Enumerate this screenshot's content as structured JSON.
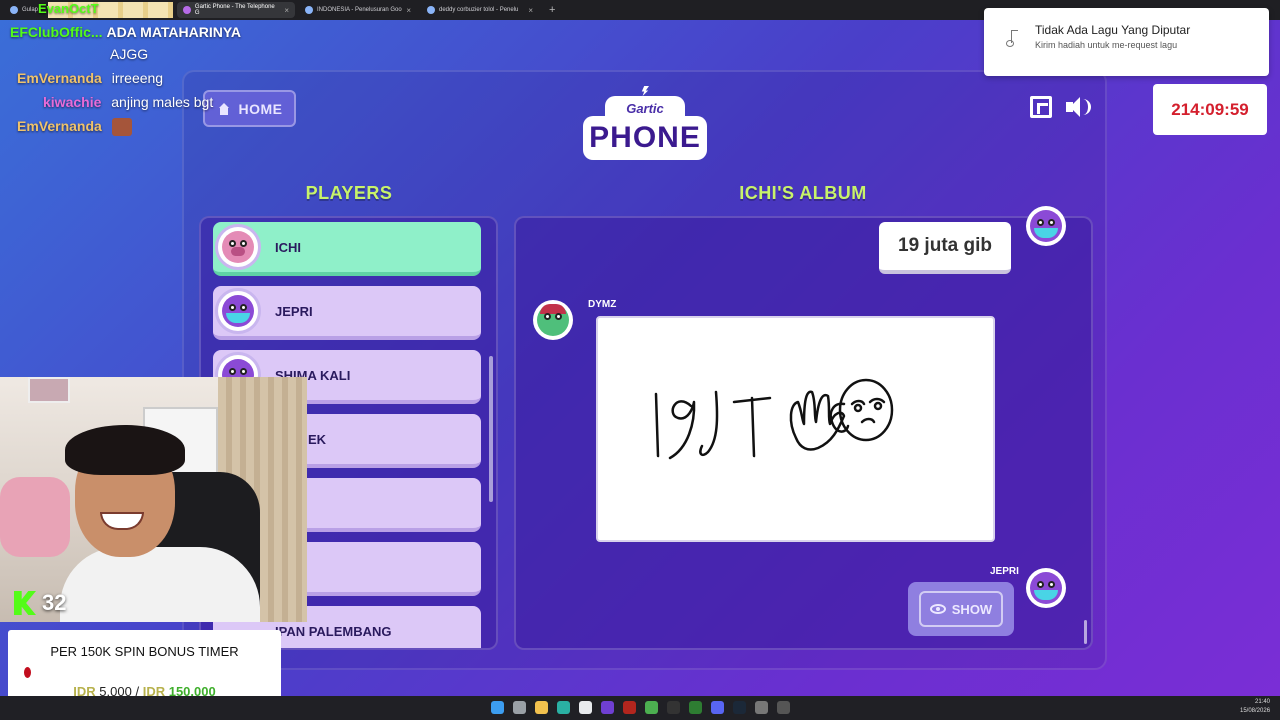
{
  "browser": {
    "tabs": [
      {
        "label": "Gulap"
      },
      {
        "label": "Gartic Phone - The Telephone G"
      },
      {
        "label": "INDONESIA - Penelusuran Goo"
      },
      {
        "label": "deddy corbuzier tolol - Penelu"
      }
    ],
    "new_tab": "+"
  },
  "chat": [
    {
      "user": "EvanOctT",
      "message": "",
      "color": "#53fc18"
    },
    {
      "user": "EFClubOffic...",
      "message": "ADA MATAHARINYA",
      "color": "#53fc18"
    },
    {
      "user": "",
      "message": "AJGG",
      "color": "#ffffff"
    },
    {
      "user": "EmVernanda",
      "message": "irreeeng",
      "color": "#f0c36a"
    },
    {
      "user": "kiwachie",
      "message": "anjing males bgt",
      "color": "#e86bd8"
    },
    {
      "user": "EmVernanda",
      "message": "",
      "color": "#f0c36a"
    }
  ],
  "game": {
    "home_label": "HOME",
    "logo_top": "Gartic",
    "logo_main": "PHONE",
    "players_title": "PLAYERS",
    "album_title": "ICHI'S ALBUM",
    "players": [
      {
        "name": "ICHI",
        "avatar": "pig",
        "active": true
      },
      {
        "name": "JEPRI",
        "avatar": "bird",
        "active": false
      },
      {
        "name": "SHIMA KALI",
        "avatar": "bird",
        "active": false
      },
      {
        "name": "EK",
        "avatar": "bird",
        "active": false
      },
      {
        "name": "",
        "avatar": "bird",
        "active": false
      },
      {
        "name": "",
        "avatar": "bird",
        "active": false
      },
      {
        "name": "IPAN PALEMBANG",
        "avatar": "bird",
        "active": false
      }
    ],
    "album": {
      "top_text": "19 juta gib",
      "drawing_author": "DYMZ",
      "next_author": "JEPRI",
      "show_label": "SHOW"
    }
  },
  "music": {
    "title": "Tidak Ada Lagu Yang Diputar",
    "subtitle": "Kirim hadiah untuk me-request lagu"
  },
  "timer": "214:09:59",
  "kick": {
    "viewers": "32",
    "accent": "#53fc18"
  },
  "donation": {
    "title": "PER 150K SPIN BONUS TIMER",
    "currency": "IDR",
    "current": "5.000",
    "separator": "/",
    "target_currency": "IDR",
    "target": "150.000"
  },
  "taskbar": {
    "time": "21:40",
    "date": "15/08/2026"
  },
  "colors": {
    "accent_green": "#c8f36a",
    "active_row": "#8ff0c9",
    "timer_red": "#d41f2d"
  }
}
